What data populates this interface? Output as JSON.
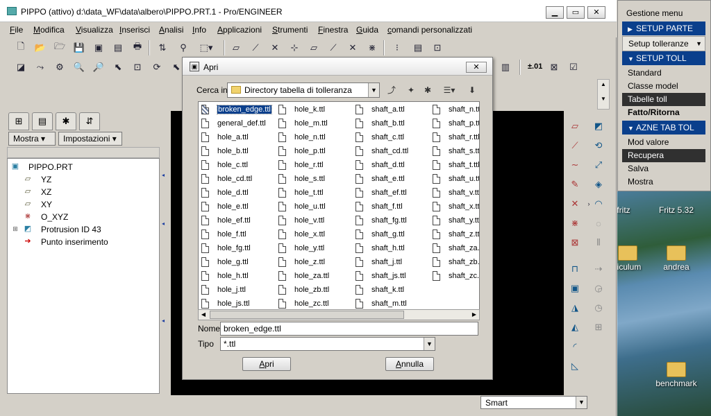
{
  "window": {
    "title": "PIPPO (attivo)  d:\\data_WF\\data\\albero\\PIPPO.PRT.1 - Pro/ENGINEER",
    "minimize_icon": "minimize-icon",
    "maximize_icon": "maximize-icon",
    "close_icon": "close-icon"
  },
  "menubar": [
    "File",
    "Modifica",
    "Visualizza",
    "Inserisci",
    "Analisi",
    "Info",
    "Applicazioni",
    "Strumenti",
    "Finestra",
    "Guida",
    "comandi personalizzati"
  ],
  "left_panel": {
    "mostra_label": "Mostra ▾",
    "impostazioni_label": "Impostazioni ▾",
    "tree": [
      {
        "label": "PIPPO.PRT",
        "icon": "part-icon"
      },
      {
        "label": "YZ",
        "icon": "datum-plane-icon"
      },
      {
        "label": "XZ",
        "icon": "datum-plane-icon"
      },
      {
        "label": "XY",
        "icon": "datum-plane-icon"
      },
      {
        "label": "O_XYZ",
        "icon": "csys-icon"
      },
      {
        "label": "Protrusion ID 43",
        "icon": "protrusion-icon"
      },
      {
        "label": "Punto inserimento",
        "icon": "insert-arrow-icon"
      }
    ]
  },
  "status": {
    "smart": "Smart"
  },
  "menu_manager": {
    "title": "Gestione menu",
    "setup_parte": "SETUP PARTE",
    "setup_tolleranze": "Setup tolleranze",
    "setup_toll": "SETUP TOLL",
    "standard": "Standard",
    "classe_model": "Classe model",
    "tabelle_toll": "Tabelle toll",
    "fatto_ritorna": "Fatto/Ritorna",
    "azne_tab_tol": "AZNE TAB TOL",
    "mod_valore": "Mod valore",
    "recupera": "Recupera",
    "salva": "Salva",
    "mostra": "Mostra"
  },
  "desktop": {
    "fritz": "fritz",
    "fritz532": "Fritz 5.32",
    "riculum": "riculum",
    "andrea": "andrea",
    "benchmark": "benchmark"
  },
  "dialog": {
    "title": "Apri",
    "look_in_label": "Cerca in",
    "look_in_value": "Directory tabella di tolleranza",
    "name_label": "Nome",
    "name_value": "broken_edge.ttl",
    "type_label": "Tipo",
    "type_value": "*.ttl",
    "open_button": "Apri",
    "cancel_button": "Annulla",
    "files": [
      [
        "broken_edge.ttl",
        "general_def.ttl",
        "hole_a.ttl",
        "hole_b.ttl",
        "hole_c.ttl",
        "hole_cd.ttl",
        "hole_d.ttl",
        "hole_e.ttl",
        "hole_ef.ttl",
        "hole_f.ttl",
        "hole_fg.ttl",
        "hole_g.ttl",
        "hole_h.ttl",
        "hole_j.ttl",
        "hole_js.ttl"
      ],
      [
        "hole_k.ttl",
        "hole_m.ttl",
        "hole_n.ttl",
        "hole_p.ttl",
        "hole_r.ttl",
        "hole_s.ttl",
        "hole_t.ttl",
        "hole_u.ttl",
        "hole_v.ttl",
        "hole_x.ttl",
        "hole_y.ttl",
        "hole_z.ttl",
        "hole_za.ttl",
        "hole_zb.ttl",
        "hole_zc.ttl"
      ],
      [
        "shaft_a.ttl",
        "shaft_b.ttl",
        "shaft_c.ttl",
        "shaft_cd.ttl",
        "shaft_d.ttl",
        "shaft_e.ttl",
        "shaft_ef.ttl",
        "shaft_f.ttl",
        "shaft_fg.ttl",
        "shaft_g.ttl",
        "shaft_h.ttl",
        "shaft_j.ttl",
        "shaft_js.ttl",
        "shaft_k.ttl",
        "shaft_m.ttl"
      ],
      [
        "shaft_n.tt",
        "shaft_p.tt",
        "shaft_r.ttl",
        "shaft_s.tt",
        "shaft_t.ttl",
        "shaft_u.tt",
        "shaft_v.tt",
        "shaft_x.tt",
        "shaft_y.tt",
        "shaft_z.tt",
        "shaft_za.t",
        "shaft_zb.t",
        "shaft_zc.t"
      ]
    ]
  },
  "toolbar": {
    "tol_label": "±.01"
  }
}
